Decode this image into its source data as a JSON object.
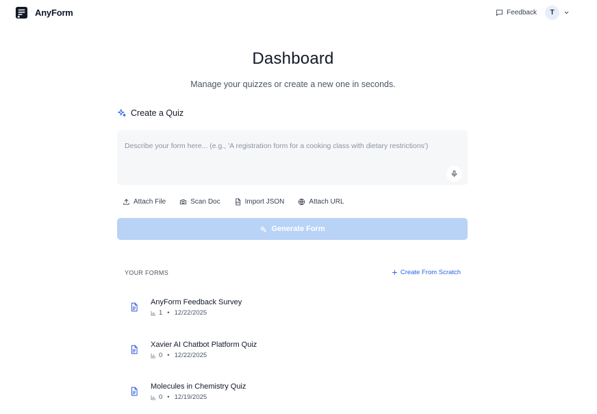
{
  "header": {
    "brand": "AnyForm",
    "feedback_label": "Feedback",
    "avatar_initial": "T"
  },
  "page": {
    "title": "Dashboard",
    "subtitle": "Manage your quizzes or create a new one in seconds."
  },
  "create": {
    "heading": "Create a Quiz",
    "input_value": "",
    "placeholder": "Describe your form here... (e.g., 'A registration form for a cooking class with dietary restrictions')",
    "attach_actions": [
      {
        "label": "Attach File",
        "icon": "upload-icon"
      },
      {
        "label": "Scan Doc",
        "icon": "camera-icon"
      },
      {
        "label": "Import JSON",
        "icon": "file-code-icon"
      },
      {
        "label": "Attach URL",
        "icon": "globe-icon"
      }
    ],
    "generate_label": "Generate Form"
  },
  "forms": {
    "section_label": "YOUR FORMS",
    "create_from_scratch_label": "Create From Scratch",
    "items": [
      {
        "title": "AnyForm Feedback Survey",
        "responses": "1",
        "date": "12/22/2025"
      },
      {
        "title": "Xavier AI Chatbot Platform Quiz",
        "responses": "0",
        "date": "12/22/2025"
      },
      {
        "title": "Molecules in Chemistry Quiz",
        "responses": "0",
        "date": "12/19/2025"
      }
    ]
  },
  "colors": {
    "accent": "#2563eb",
    "generate_disabled": "#b9d3f7",
    "input_bg": "#f6f7f9"
  }
}
